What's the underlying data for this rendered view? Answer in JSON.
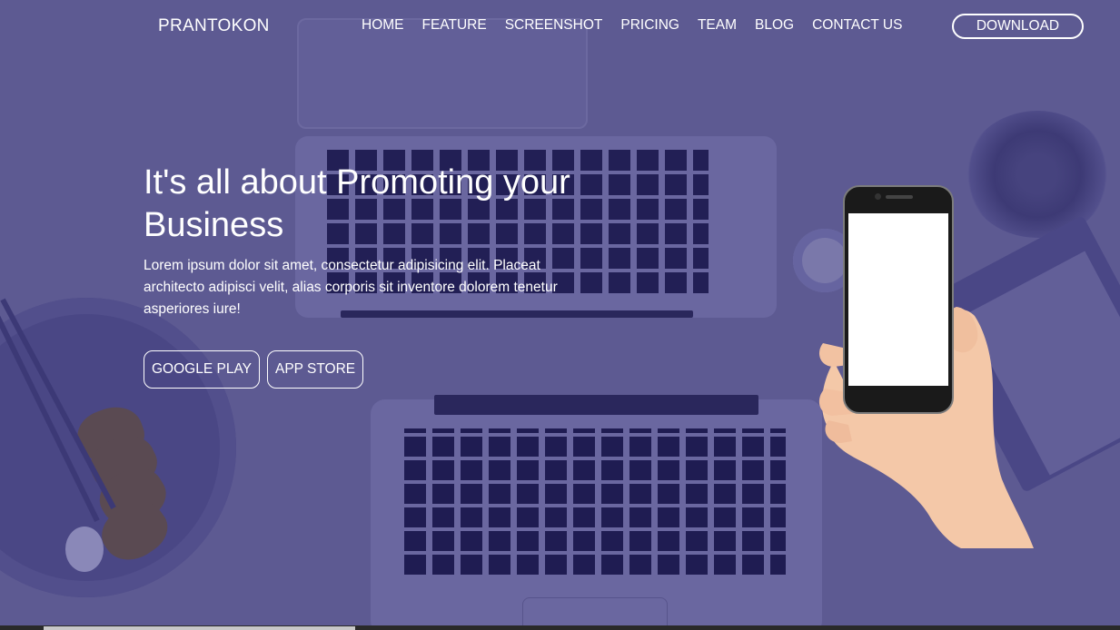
{
  "header": {
    "logo": "PRANTOKON",
    "nav": [
      "HOME",
      "FEATURE",
      "SCREENSHOT",
      "PRICING",
      "TEAM",
      "BLOG",
      "CONTACT US"
    ],
    "download_label": "DOWNLOAD"
  },
  "hero": {
    "title": "It's all about Promoting your Business",
    "text": "Lorem ipsum dolor sit amet, consectetur adipisicing elit. Placeat architecto adipisci velit, alias corporis sit inventore dolorem tenetur asperiores iure!",
    "buttons": [
      "GOOGLE PLAY",
      "APP STORE"
    ]
  },
  "colors": {
    "overlay": "#5d5a92",
    "text": "#ffffff"
  },
  "icons": {
    "phone": "smartphone-in-hand-icon"
  }
}
